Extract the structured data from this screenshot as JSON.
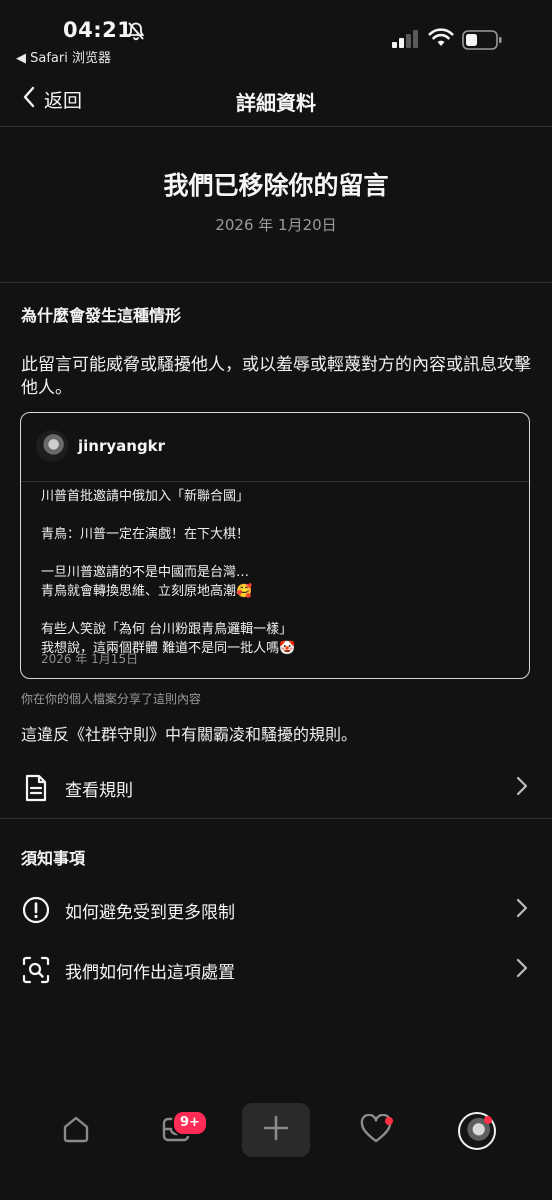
{
  "status_bar": {
    "time": "04:21",
    "back_app": "◀ Safari 浏览器"
  },
  "nav": {
    "back_label": "返回",
    "title": "詳細資料"
  },
  "notice": {
    "headline": "我們已移除你的留言",
    "date": "2026 年 1月20日"
  },
  "why": {
    "heading": "為什麼會發生這種情形",
    "reason": "此留言可能威脅或騷擾他人，或以羞辱或輕蔑對方的內容或訊息攻擊他人。"
  },
  "post": {
    "username": "jinryangkr",
    "lines": [
      "川普首批邀請中俄加入「新聯合國」",
      "",
      "青鳥：川普一定在演戲！在下大棋！",
      "",
      "一旦川普邀請的不是中國而是台灣…",
      "青鳥就會轉換思維、立刻原地高潮🥰",
      "",
      "有些人笑說「為何 台川粉跟青鳥邏輯一樣」",
      "我想說，這兩個群體 難道不是同一批人嗎🤡"
    ],
    "date": "2026 年 1月15日"
  },
  "shared_note": "你在你的個人檔案分享了這則內容",
  "violation": "這違反《社群守則》中有關霸凌和騷擾的規則。",
  "view_rules": "查看規則",
  "know": {
    "heading": "須知事項",
    "item1": "如何避免受到更多限制",
    "item2": "我們如何作出這項處置"
  },
  "tabbar": {
    "badge": "9+"
  },
  "icons": {
    "bell": "bell-slash-icon",
    "signal": "cellular-signal-icon",
    "wifi": "wifi-icon",
    "battery": "battery-icon",
    "back": "chevron-left-icon",
    "document": "document-icon",
    "alert": "exclamation-circle-icon",
    "scan": "scan-search-icon",
    "home": "home-icon",
    "inbox": "inbox-icon",
    "plus": "plus-icon",
    "heart": "heart-icon"
  },
  "colors": {
    "background": "#121212",
    "badge": "#ff2d55",
    "dot": "#ff3040"
  }
}
